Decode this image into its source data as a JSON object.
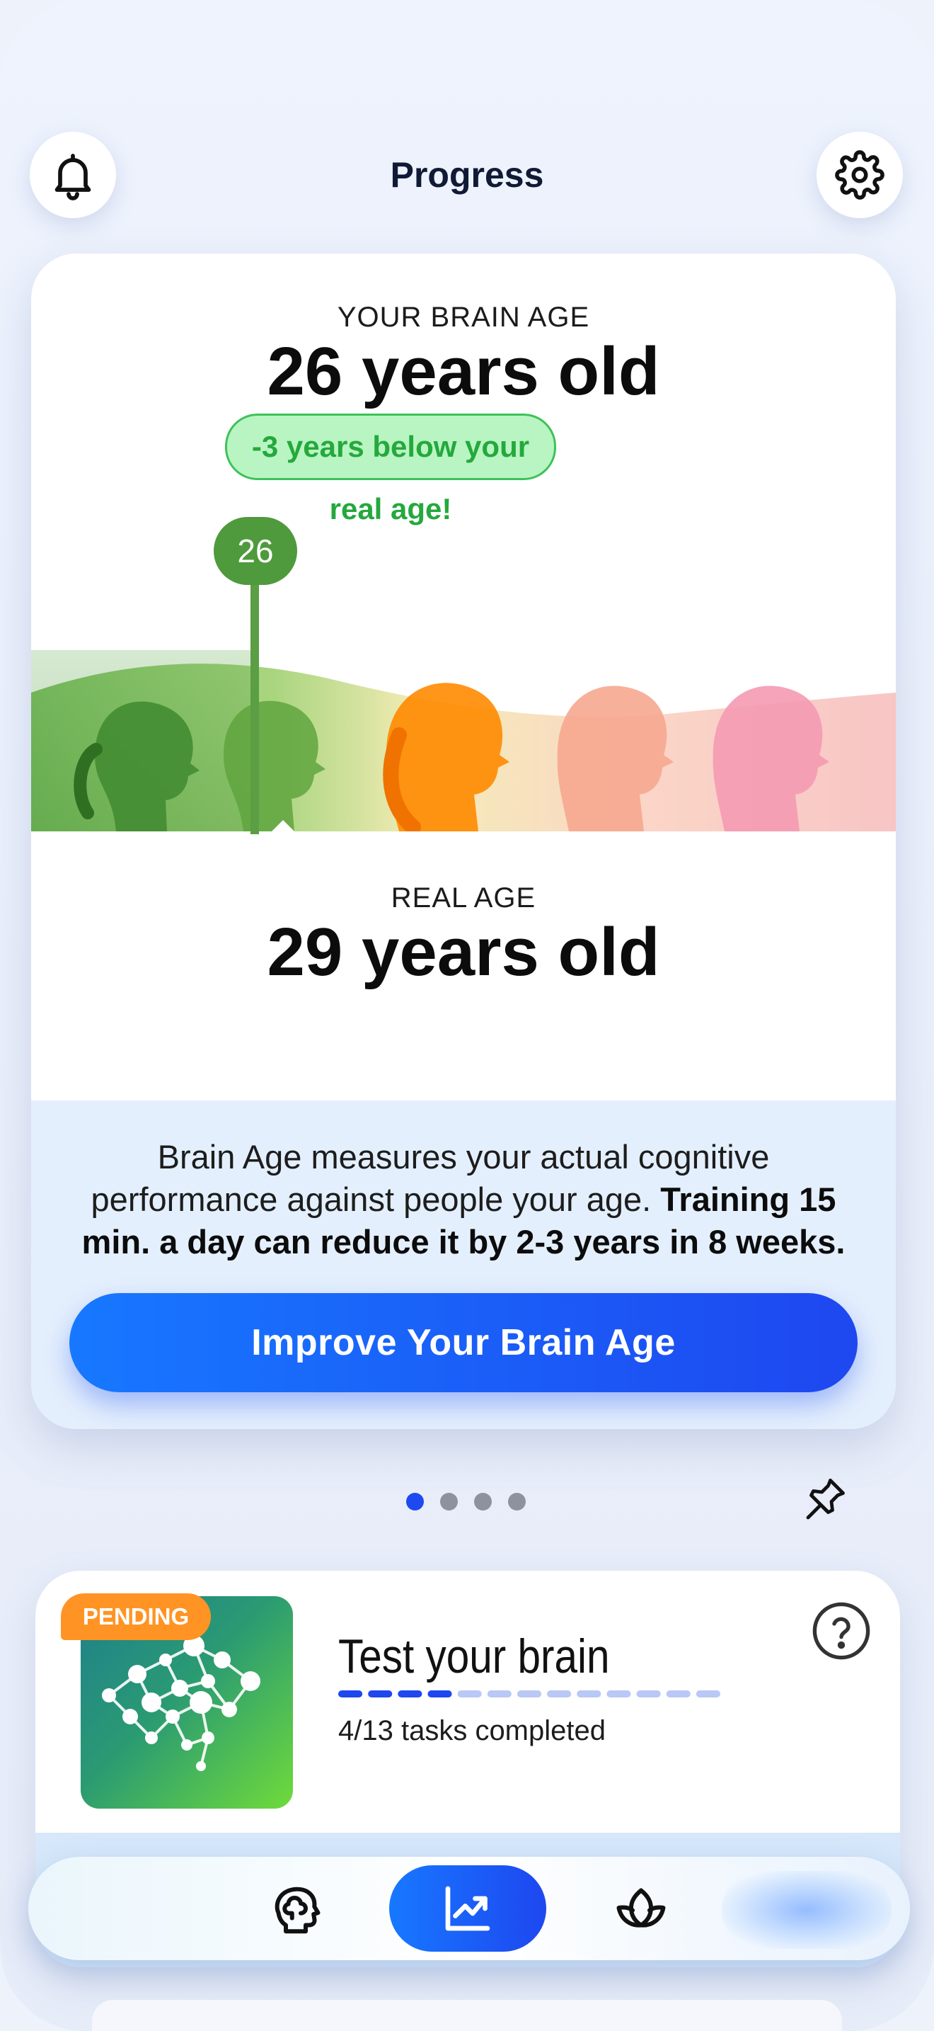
{
  "header": {
    "title": "Progress",
    "left_icon": "bell-icon",
    "right_icon": "gear-icon"
  },
  "brain_age_card": {
    "brain_age_label": "YOUR BRAIN AGE",
    "brain_age_value": "26 years old",
    "difference": "-3 years below your real age!",
    "marker_value": "26",
    "real_age_label": "REAL AGE",
    "real_age_value": "29 years old",
    "info_text_plain": "Brain Age measures your actual cognitive performance against people your age. ",
    "info_text_bold": "Training 15 min. a day can reduce it by 2-3 years in 8 weeks.",
    "cta_label": "Improve Your Brain Age"
  },
  "pager": {
    "pages": 4,
    "active_index": 0,
    "pin_icon": "pin-icon"
  },
  "test_card": {
    "badge": "PENDING",
    "title": "Test your brain",
    "subtitle": "4/13 tasks completed",
    "tasks_completed": 4,
    "tasks_total": 13,
    "help_icon": "help-icon"
  },
  "bottom_nav": {
    "items": [
      "brain-icon",
      "progress-chart-icon",
      "lotus-icon"
    ],
    "active": "progress-chart-icon"
  },
  "colors": {
    "accent_blue": "#1e47f0",
    "success_green": "#25a83c",
    "pending_orange": "#ff9424"
  }
}
